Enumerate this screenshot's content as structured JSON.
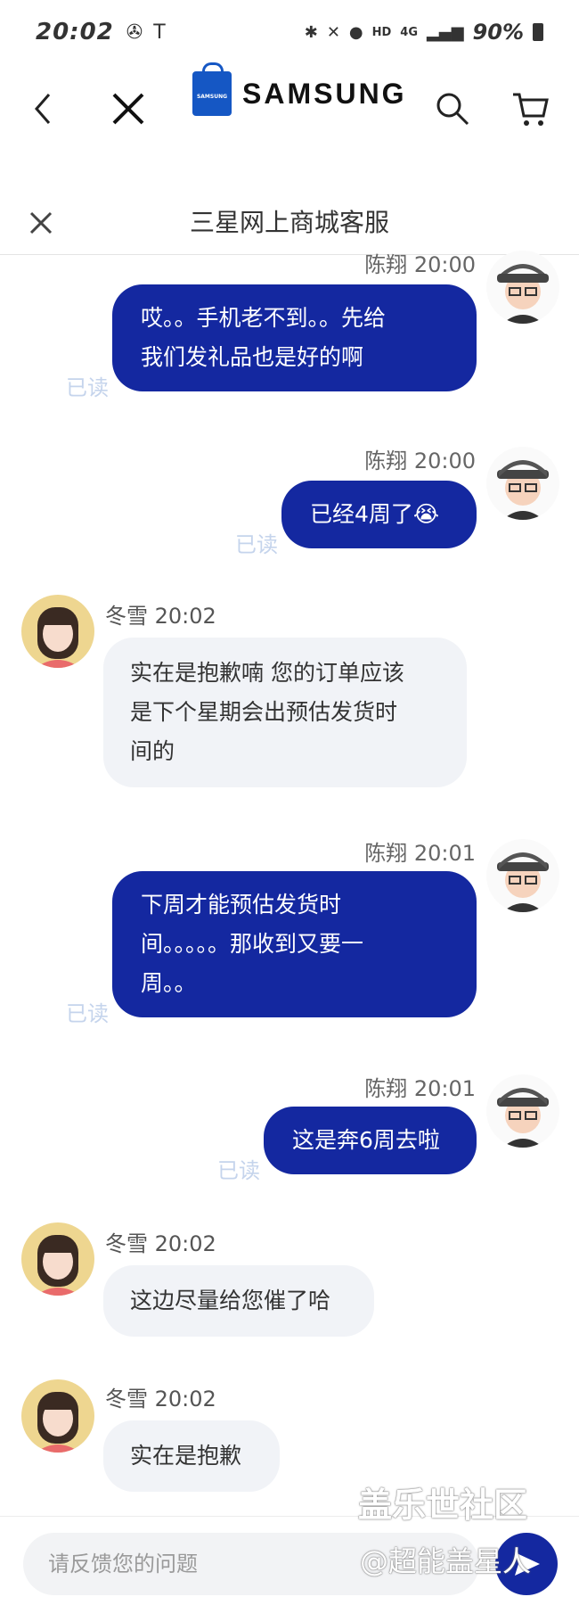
{
  "status_bar": {
    "time": "20:02",
    "network": "HD",
    "signal_type": "4G",
    "battery": "90%"
  },
  "header": {
    "brand": "SAMSUNG",
    "bag_label": "SAMSUNG"
  },
  "chat": {
    "title": "三星网上商城客服"
  },
  "messages": [
    {
      "sender": "陈翔",
      "time": "20:00",
      "line1": "哎。。手机老不到。。先给",
      "line2": "我们发礼品也是好的啊",
      "status": "已读"
    },
    {
      "sender": "陈翔",
      "time": "20:00",
      "text": "已经4周了😭",
      "status": "已读"
    },
    {
      "sender": "冬雪",
      "time": "20:02",
      "line1": "实在是抱歉喃 您的订单应该",
      "line2": "是下个星期会出预估发货时",
      "line3": "间的"
    },
    {
      "sender": "陈翔",
      "time": "20:01",
      "line1": "下周才能预估发货时",
      "line2": "间。。。。。那收到又要一",
      "line3": "周。。",
      "status": "已读"
    },
    {
      "sender": "陈翔",
      "time": "20:01",
      "text": "这是奔6周去啦",
      "status": "已读"
    },
    {
      "sender": "冬雪",
      "time": "20:02",
      "text": "这边尽量给您催了哈"
    },
    {
      "sender": "冬雪",
      "time": "20:02",
      "text": "实在是抱歉"
    }
  ],
  "input": {
    "placeholder": "请反馈您的问题"
  },
  "watermark": {
    "line1": "盖乐世社区",
    "line2": "@超能盖星人"
  }
}
